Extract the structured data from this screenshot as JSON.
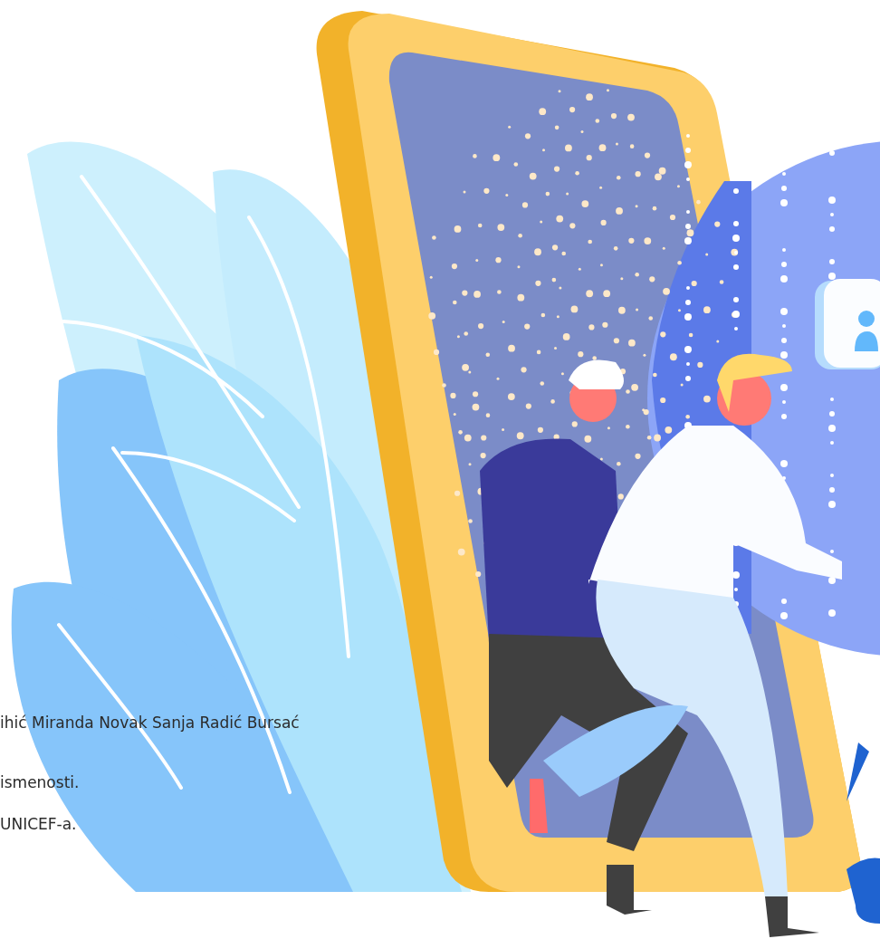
{
  "paragraphs": [
    {
      "text": "ihić Miranda Novak Sanja Radić Bursać"
    },
    {
      "text": "ismenosti."
    },
    {
      "text": "UNICEF-a."
    }
  ]
}
